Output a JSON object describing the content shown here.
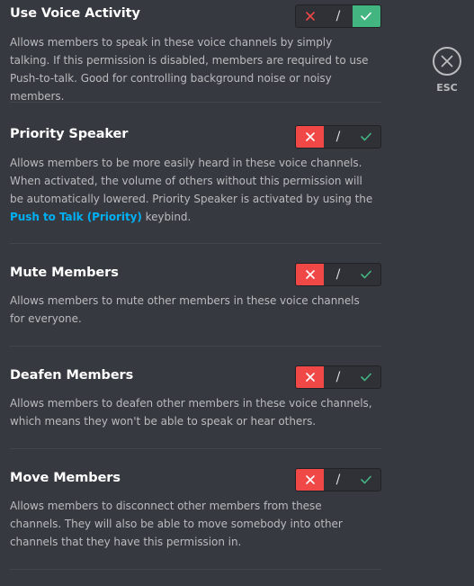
{
  "permissions": [
    {
      "title": "Use Voice Activity",
      "desc": "Allows members to speak in these voice channels by simply talking. If this permission is disabled, members are required to use Push-to-talk. Good for controlling background noise or noisy members.",
      "state": "allow"
    },
    {
      "title": "Priority Speaker",
      "desc_before": "Allows members to be more easily heard in these voice channels. When activated, the volume of others without this permission will be automatically lowered. Priority Speaker is activated by using the ",
      "desc_link": "Push to Talk (Priority)",
      "desc_after": " keybind.",
      "state": "deny"
    },
    {
      "title": "Mute Members",
      "desc": "Allows members to mute other members in these voice channels for everyone.",
      "state": "deny"
    },
    {
      "title": "Deafen Members",
      "desc": "Allows members to deafen other members in these voice channels, which means they won't be able to speak or hear others.",
      "state": "deny"
    },
    {
      "title": "Move Members",
      "desc": "Allows members to disconnect other members from these channels. They will also be able to move somebody into other channels that they have this permission in.",
      "state": "deny"
    }
  ],
  "toggle": {
    "deny_icon": "x-icon",
    "neutral_label": "/",
    "allow_icon": "check-icon"
  },
  "close": {
    "icon": "close-icon",
    "label": "ESC"
  },
  "colors": {
    "background": "#36393f",
    "deny": "#f04747",
    "allow": "#43b581",
    "link": "#00b0f4"
  }
}
